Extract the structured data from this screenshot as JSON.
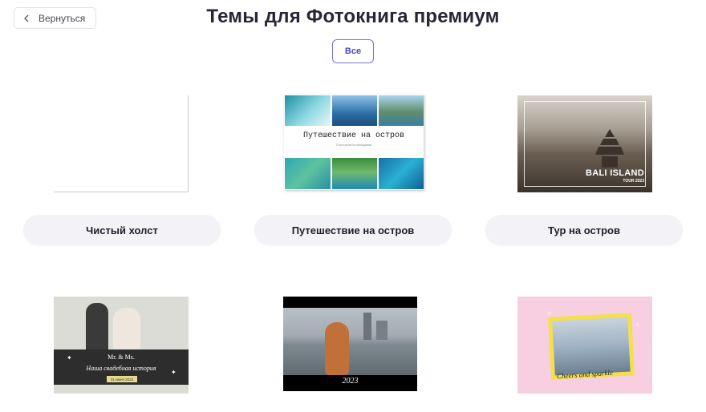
{
  "header": {
    "back_label": "Вернуться",
    "title": "Темы для Фотокнига премиум"
  },
  "filters": {
    "all_label": "Все"
  },
  "themes": [
    {
      "label": "Чистый холст"
    },
    {
      "label": "Путешествие на остров",
      "cover_title": "Путешествие на остров",
      "cover_subtitle": "О прогулках по Мальдивам"
    },
    {
      "label": "Тур на остров",
      "cover_title": "BALI ISLAND",
      "cover_subtitle": "TOUR 2023"
    },
    {
      "cover_names": "Mr. & Ms.",
      "cover_story": "Наша свадебная история",
      "cover_date": "31 июня 2023"
    },
    {
      "cover_year": "2023"
    },
    {
      "cover_caption": "Cheers and sparkle"
    }
  ],
  "colors": {
    "accent": "#5b54c4",
    "label_bg": "#f3f2f7"
  }
}
